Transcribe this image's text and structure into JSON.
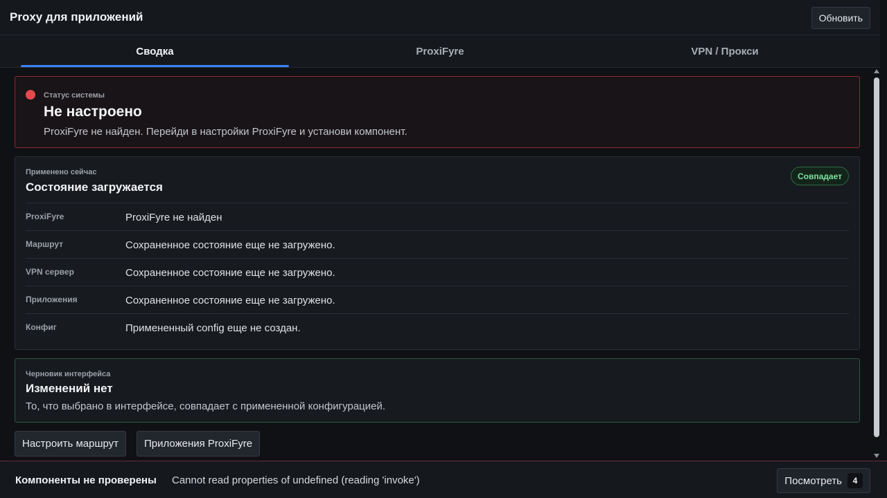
{
  "header": {
    "title": "Proxy для приложений",
    "refresh_label": "Обновить"
  },
  "tabs": [
    {
      "label": "Сводка",
      "active": true
    },
    {
      "label": "ProxiFyre",
      "active": false
    },
    {
      "label": "VPN / Прокси",
      "active": false
    }
  ],
  "status": {
    "label": "Статус системы",
    "title": "Не настроено",
    "description": "ProxiFyre не найден. Перейди в настройки ProxiFyre и установи компонент.",
    "color": "#e5484d"
  },
  "applied": {
    "label": "Применено сейчас",
    "title": "Состояние загружается",
    "badge": "Совпадает",
    "rows": [
      {
        "key": "ProxiFyre",
        "value": "ProxiFyre не найден"
      },
      {
        "key": "Маршрут",
        "value": "Сохраненное состояние еще не загружено."
      },
      {
        "key": "VPN сервер",
        "value": "Сохраненное состояние еще не загружено."
      },
      {
        "key": "Приложения",
        "value": "Сохраненное состояние еще не загружено."
      },
      {
        "key": "Конфиг",
        "value": "Примененный config еще не создан."
      }
    ]
  },
  "draft": {
    "label": "Черновик интерфейса",
    "title": "Изменений нет",
    "description": "То, что выбрано в интерфейсе, совпадает с примененной конфигурацией."
  },
  "actions": {
    "configure_route": "Настроить маршрут",
    "proxifyre_apps": "Приложения ProxiFyre"
  },
  "footer": {
    "title": "Компоненты не проверены",
    "message": "Cannot read properties of undefined (reading 'invoke')",
    "view_label": "Посмотреть",
    "view_count": "4"
  },
  "colors": {
    "accent": "#3b82f6",
    "error": "#e5484d",
    "success": "#7ee0a0"
  }
}
